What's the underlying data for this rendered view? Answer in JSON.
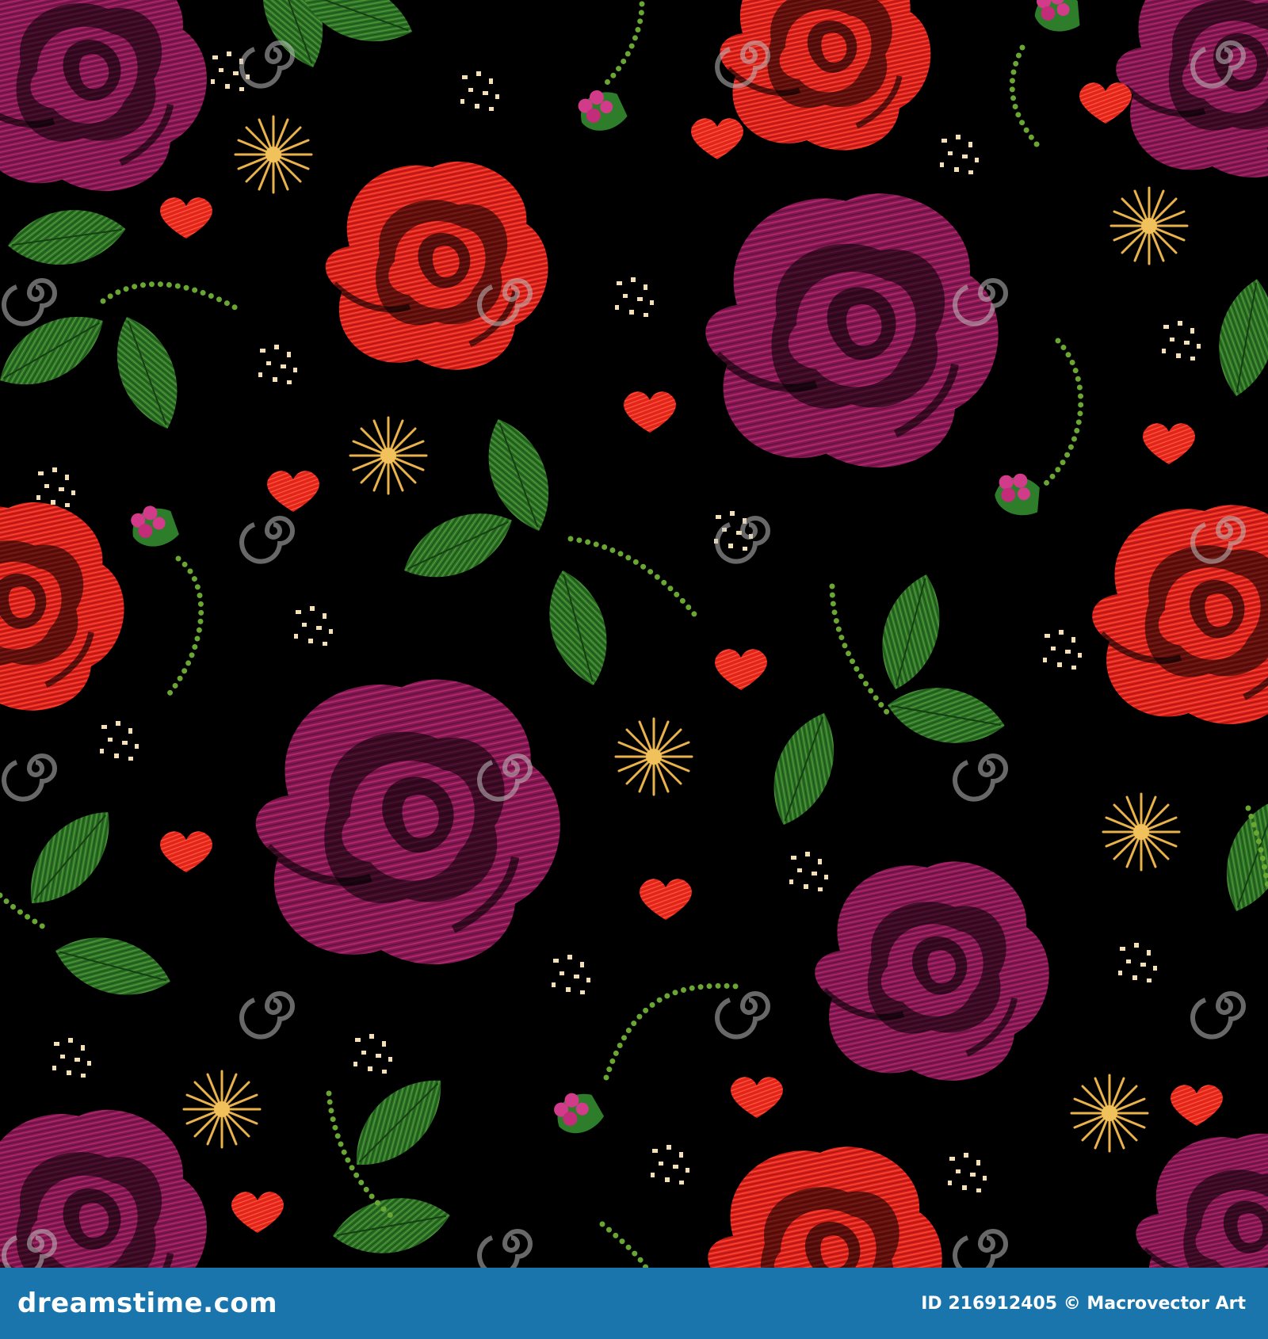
{
  "image": {
    "subject": "embroidery-seamless-pattern",
    "background_color": "#000000",
    "motif_colors": {
      "rose_red": "#e8231e",
      "rose_magenta": "#8e1a5a",
      "leaf_green": "#2e7d2a",
      "stem_green": "#6aa632",
      "heart_red": "#ef2a1c",
      "daisy_gold": "#e9b24a",
      "dot_cream": "#f5dfb5",
      "bud_pink": "#d23b8a"
    },
    "watermark": {
      "text": "dreamstime",
      "icon": "spiral-watermark-icon"
    }
  },
  "footer": {
    "background_color": "#1a75ad",
    "site": "dreamstime.com",
    "credit": "ID 216912405 © Macrovector Art"
  }
}
